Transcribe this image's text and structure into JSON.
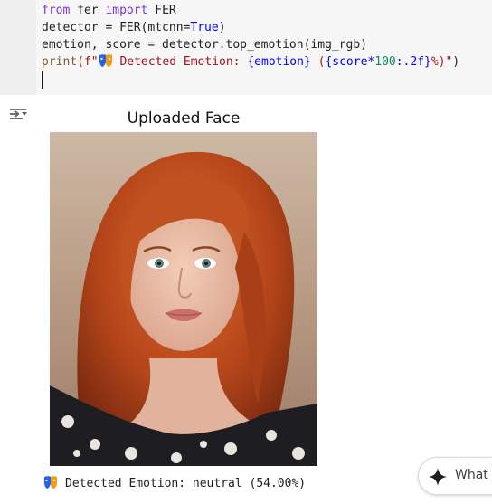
{
  "code": {
    "line1": {
      "kw1": "from",
      "mod": " fer ",
      "kw2": "import",
      "rest": " FER"
    },
    "line2": {
      "a": "detector = FER(mtcnn=",
      "val": "True",
      "b": ")"
    },
    "line3": {
      "text": "emotion, score = detector.top_emotion(img_rgb)"
    },
    "line4": {
      "fn": "print",
      "open": "(f\"",
      "s1": " Detected Emotion: ",
      "e1": "{emotion}",
      "s2": " (",
      "e2open": "{score*",
      "num": "100",
      "e2close": ":.2f}",
      "s3": "%)\"",
      "close": ")"
    }
  },
  "output": {
    "plot_title": "Uploaded Face",
    "result_text": "Detected Emotion: neutral (54.00%)"
  },
  "assistant": {
    "label": "What c"
  },
  "icons": {
    "output_icon": "output-settings-icon",
    "emoji": "mask-emoji-icon",
    "assist": "sparkle-icon"
  }
}
